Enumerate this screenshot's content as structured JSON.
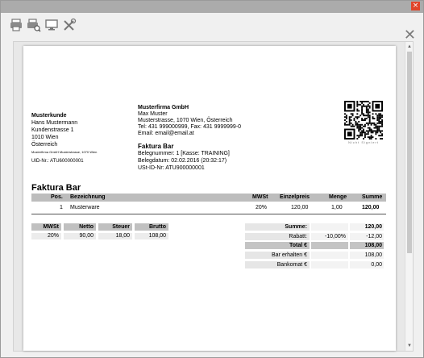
{
  "window": {
    "close_glyph": "×"
  },
  "toolbar": {
    "icons": [
      "printer-icon",
      "print-preview-icon",
      "monitor-icon",
      "tools-icon"
    ],
    "close_glyph": "✕"
  },
  "customer": {
    "name": "Musterkunde",
    "person": "Hans Mustermann",
    "street": "Kundenstrasse 1",
    "city": "1010 Wien",
    "country": "Österreich",
    "sender_line": "Musterfirma GmbH Musterstrasse, 1070 Wien",
    "uid": "UID-Nr.: ATU600000001"
  },
  "company": {
    "name": "Musterfirma GmbH",
    "contact": "Max Muster",
    "address": "Musterstrasse, 1070 Wien, Österreich",
    "phone": "Tel: 431 999000999, Fax: 431 9999999-0",
    "email": "Email: email@email.at"
  },
  "receipt": {
    "title": "Faktura Bar",
    "number": "Belegnummer: 1 [Kasse: TRAINING]",
    "date": "Belegdatum: 02.02.2016 (20:32:17)",
    "ustid": "USt-ID-Nr: ATU900000001"
  },
  "qr": {
    "caption": "Nicht Signiert"
  },
  "document_title": "Faktura Bar",
  "items_table": {
    "headers": {
      "pos": "Pos.",
      "desc": "Bezeichnung",
      "vat": "MWSt",
      "unit": "Einzelpreis",
      "qty": "Menge",
      "sum": "Summe"
    },
    "rows": [
      {
        "pos": "1",
        "desc": "Musterware",
        "vat": "20%",
        "unit": "120,00",
        "qty": "1,00",
        "sum": "120,00"
      }
    ]
  },
  "vat_table": {
    "headers": {
      "vat": "MWSt",
      "net": "Netto",
      "tax": "Steuer",
      "gross": "Brutto"
    },
    "row": {
      "vat": "20%",
      "net": "90,00",
      "tax": "18,00",
      "gross": "108,00"
    }
  },
  "totals": {
    "sum_label": "Summe:",
    "sum_value": "120,00",
    "discount_label": "Rabatt:",
    "discount_pct": "-10,00%",
    "discount_value": "-12,00",
    "total_label": "Total €",
    "total_value": "108,00",
    "cash_label": "Bar erhalten €",
    "cash_value": "108,00",
    "card_label": "Bankomat €",
    "card_value": "0,00"
  }
}
